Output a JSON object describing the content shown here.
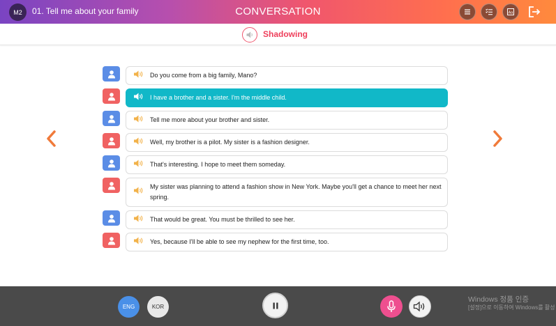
{
  "header": {
    "module_badge": "M2",
    "lesson_title": "01. Tell me about your family",
    "app_title": "CONVERSATION",
    "buttons": [
      "menu-icon",
      "checklist-icon",
      "text-size-icon"
    ],
    "exit_icon": "exit-icon"
  },
  "mode": {
    "label": "Shadowing",
    "icon": "speaker-icon",
    "color": "#ee3f5b"
  },
  "dialogue": [
    {
      "speaker": "A",
      "text": "Do you come from a big family, Mano?"
    },
    {
      "speaker": "B",
      "text": "I have a brother and a sister. I'm the middle child.",
      "active": true
    },
    {
      "speaker": "A",
      "text": "Tell me more about your brother and sister."
    },
    {
      "speaker": "B",
      "text": "Well, my brother is a pilot. My sister is a fashion designer."
    },
    {
      "speaker": "A",
      "text": "That's interesting. I hope to meet them someday."
    },
    {
      "speaker": "B",
      "text": "My sister was planning to attend a fashion show in New York. Maybe you'll get a chance to meet her next spring."
    },
    {
      "speaker": "A",
      "text": "That would be great. You must be thrilled to see her."
    },
    {
      "speaker": "B",
      "text": "Yes, because I'll be able to see my nephew for the first time, too."
    }
  ],
  "colors": {
    "speaker_a": "#5b8de6",
    "speaker_b": "#f06262",
    "active_row": "#11b8c8",
    "nav_arrow": "#f07a3a"
  },
  "footer": {
    "lang_eng": "ENG",
    "lang_kor": "KOR",
    "windows_title": "Windows 정품 인증",
    "windows_subtitle": "[설정]으로 이동하여 Windows를 활성"
  }
}
